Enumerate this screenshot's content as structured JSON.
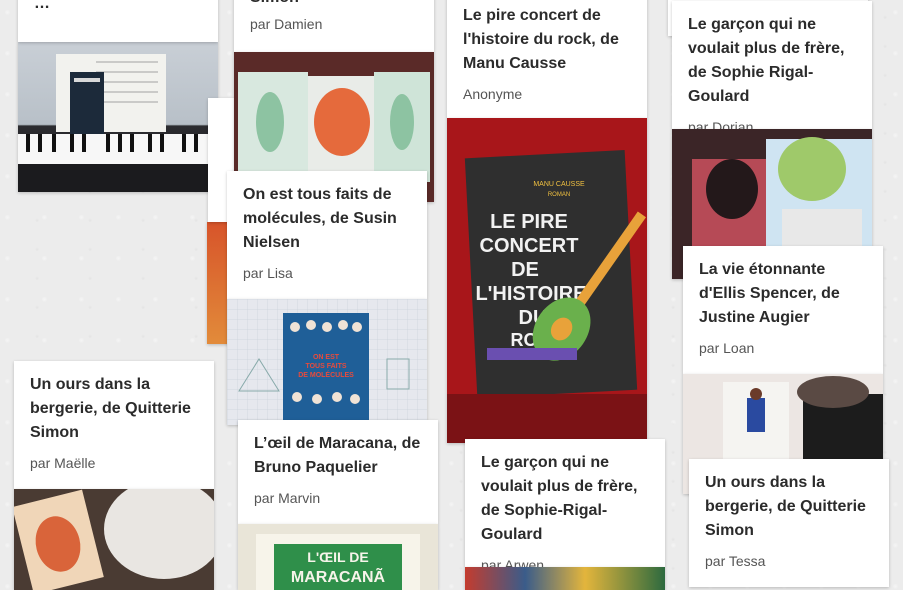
{
  "cards": {
    "top_left": {
      "title_tail": "…",
      "author": ""
    },
    "damien": {
      "title_tail": "Simon",
      "author": "par Damien"
    },
    "rock": {
      "title": "Le pire concert de l'histoire du rock, de Manu Causse",
      "author": "Anonyme"
    },
    "dorian": {
      "title": "Le garçon qui ne voulait plus de frère, de Sophie Rigal-Goulard",
      "author": "par Dorian"
    },
    "lisa": {
      "title": "On est tous faits de molécules, de Susin Nielsen",
      "author": "par Lisa"
    },
    "loan": {
      "title": "La vie étonnante d'Ellis Spencer, de Justine Augier",
      "author": "par Loan"
    },
    "maelle": {
      "title": "Un ours dans la bergerie, de Quitterie Simon",
      "author": "par Maëlle"
    },
    "marvin": {
      "title": "L’œil de Maracana, de Bruno Paquelier",
      "author": "par Marvin"
    },
    "arwen": {
      "title": "Le garçon qui ne voulait plus de frère, de Sophie-Rigal-Goulard",
      "author": "par Arwen"
    },
    "tessa": {
      "title": "Un ours dans la bergerie, de Quitterie Simon",
      "author": "par Tessa"
    }
  },
  "covers": {
    "rock": {
      "author": "MANU CAUSSE",
      "genre": "ROMAN",
      "lines": [
        "LE PIRE",
        "CONCERT",
        "DE",
        "L'HISTOIRE",
        "DU",
        "ROCK"
      ]
    },
    "molecules": {
      "lines": [
        "ON EST",
        "TOUS FAITS",
        "DE MOLÉCULES"
      ]
    },
    "maracana": {
      "lines": [
        "L'ŒIL DE",
        "MARACANÃ"
      ]
    }
  },
  "colors": {
    "background": "#ececec",
    "card": "#ffffff",
    "title": "#2b2b2b",
    "author": "#555555"
  }
}
